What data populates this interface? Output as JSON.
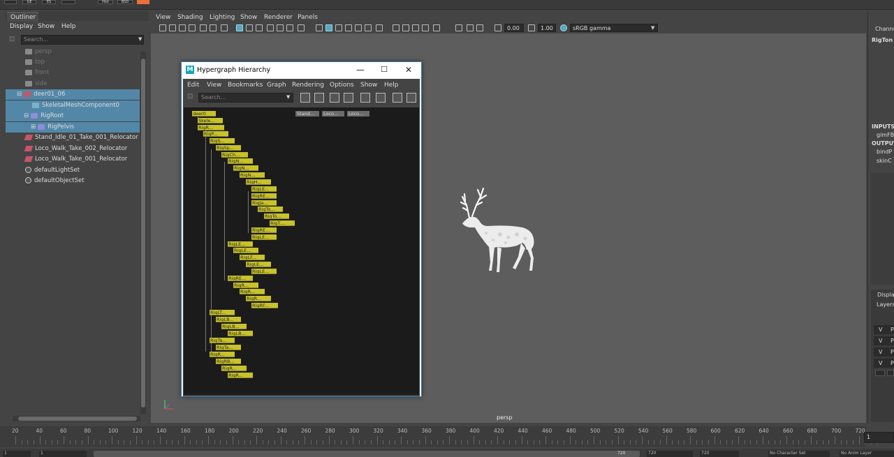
{
  "topstrip": {
    "buttons": [
      "",
      "GE",
      "ES",
      "",
      "Hist",
      "BSD"
    ],
    "accent": "#e8703a"
  },
  "outliner": {
    "tab": "Outliner",
    "menus": [
      "Display",
      "Show",
      "Help"
    ],
    "search_placeholder": "Search...",
    "items": [
      {
        "label": "persp",
        "icon": "camera-icon"
      },
      {
        "label": "top",
        "icon": "camera-icon"
      },
      {
        "label": "front",
        "icon": "camera-icon"
      },
      {
        "label": "side",
        "icon": "camera-icon"
      },
      {
        "label": "deer01_06",
        "icon": "transform-icon"
      },
      {
        "label": "SkeletalMeshComponent0",
        "icon": "mesh-icon"
      },
      {
        "label": "RigRoot",
        "icon": "joint-icon"
      },
      {
        "label": "RigPelvis",
        "icon": "joint-icon"
      },
      {
        "label": "Stand_Idle_01_Take_001_Relocator",
        "icon": "transform-icon"
      },
      {
        "label": "Loco_Walk_Take_002_Relocator",
        "icon": "transform-icon"
      },
      {
        "label": "Loco_Walk_Take_001_Relocator",
        "icon": "transform-icon"
      },
      {
        "label": "defaultLightSet",
        "icon": "set-icon"
      },
      {
        "label": "defaultObjectSet",
        "icon": "set-icon"
      }
    ]
  },
  "viewport": {
    "menus": [
      "View",
      "Shading",
      "Lighting",
      "Show",
      "Renderer",
      "Panels"
    ],
    "exposure": "0.00",
    "gamma": "1.00",
    "colorspace": "sRGB gamma",
    "camera_label": "persp",
    "background": "#5d5d5d"
  },
  "hypergraph": {
    "title": "Hypergraph Hierarchy",
    "logo": "M",
    "menus": [
      "Edit",
      "View",
      "Bookmarks",
      "Graph",
      "Rendering",
      "Options",
      "Show",
      "Help"
    ],
    "search_placeholder": "Search...",
    "nodes": [
      "deer0",
      "Skele...",
      "RigR...",
      "RigP...",
      "RigS...",
      "RigSp...",
      "RigCh...",
      "RigN...",
      "RigN...",
      "RigN...",
      "RigH...",
      "RigLE...",
      "RigRE...",
      "RigJa...",
      "RigTo...",
      "RigTo...",
      "RigT....",
      "RigRE...",
      "RigLE...",
      "RigLE...",
      "RigLE...",
      "RigLF...",
      "RigLE...",
      "RigLE...",
      "RigRE...",
      "RigR...",
      "RigR...",
      "RigR...",
      "RigRF...",
      "RigLT...",
      "RigLB...",
      "RigLB...",
      "RigLB...",
      "RigTa...",
      "RigTa...",
      "RigR...",
      "RigRB...",
      "RigR...",
      "RigR..."
    ],
    "extra_nodes": [
      "Stand...",
      "Loco...",
      "Loco..."
    ],
    "node_color": "#c8c22c"
  },
  "right_panel": {
    "channel_tab": "Channe",
    "object_name": "RigTon",
    "inputs_label": "INPUTS",
    "inputs": [
      "gimFB"
    ],
    "outputs_label": "OUTPUT",
    "outputs": [
      "bindP",
      "skinC"
    ],
    "display_tab": "Displa",
    "layers_label": "Layers",
    "layer_rows": [
      {
        "v": "V",
        "p": "P"
      },
      {
        "v": "V",
        "p": "P"
      },
      {
        "v": "V",
        "p": "P"
      },
      {
        "v": "V",
        "p": "P"
      }
    ]
  },
  "timeline": {
    "ticks": [
      "20",
      "40",
      "60",
      "80",
      "100",
      "120",
      "140",
      "160",
      "180",
      "200",
      "220",
      "240",
      "260",
      "280",
      "300",
      "320",
      "340",
      "360",
      "380",
      "400",
      "420",
      "440",
      "460",
      "480",
      "500",
      "520",
      "540",
      "560",
      "580",
      "600",
      "620",
      "640",
      "660",
      "680",
      "700",
      "720"
    ],
    "current_frame": "1"
  },
  "bottombar": {
    "fields": [
      "1",
      "1",
      "720",
      "720",
      "720",
      "No Character Set",
      "No Anim Layer"
    ]
  }
}
